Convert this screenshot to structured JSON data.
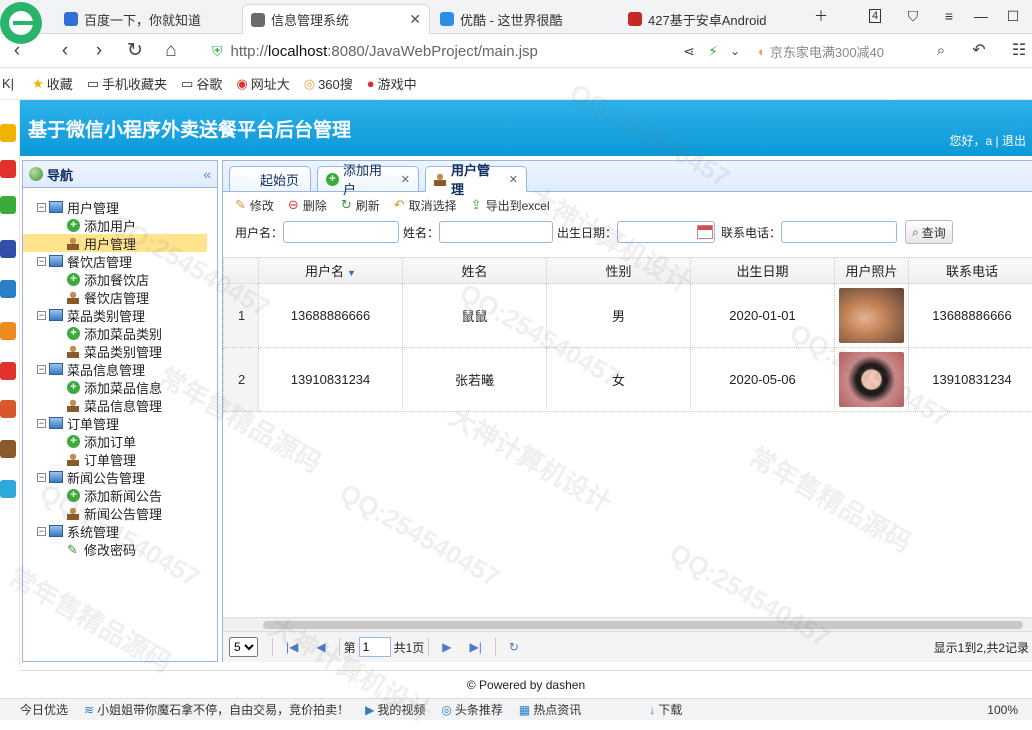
{
  "browser": {
    "tabs": [
      {
        "label": "百度一下，你就知道",
        "icon": "paw-icon",
        "color": "#2f6fd6"
      },
      {
        "label": "信息管理系统",
        "icon": "image-icon",
        "color": "#6a6a6a",
        "active": true
      },
      {
        "label": "优酷 - 这世界很酷",
        "icon": "youku-icon",
        "color": "#2a8fe6"
      },
      {
        "label": "427基于安卓Android",
        "icon": "flag-icon",
        "color": "#c62828"
      }
    ],
    "tab_count": "4",
    "url_host": "localhost",
    "url_rest": ":8080/JavaWebProject/main.jsp",
    "url_scheme": "http://",
    "search_text": "京东家电满300减40",
    "bookmarks": [
      "收藏",
      "手机收藏夹",
      "谷歌",
      "网址大",
      "360搜",
      "游戏中"
    ]
  },
  "app": {
    "title": "基于微信小程序外卖送餐平台后台管理",
    "welcome": "您好，a",
    "logout": "退出"
  },
  "nav": {
    "title": "导航",
    "groups": [
      {
        "label": "用户管理",
        "items": [
          {
            "label": "添加用户",
            "type": "add"
          },
          {
            "label": "用户管理",
            "type": "manage",
            "selected": true
          }
        ]
      },
      {
        "label": "餐饮店管理",
        "items": [
          {
            "label": "添加餐饮店",
            "type": "add"
          },
          {
            "label": "餐饮店管理",
            "type": "manage"
          }
        ]
      },
      {
        "label": "菜品类别管理",
        "items": [
          {
            "label": "添加菜品类别",
            "type": "add"
          },
          {
            "label": "菜品类别管理",
            "type": "manage"
          }
        ]
      },
      {
        "label": "菜品信息管理",
        "items": [
          {
            "label": "添加菜品信息",
            "type": "add"
          },
          {
            "label": "菜品信息管理",
            "type": "manage"
          }
        ]
      },
      {
        "label": "订单管理",
        "items": [
          {
            "label": "添加订单",
            "type": "add"
          },
          {
            "label": "订单管理",
            "type": "manage"
          }
        ]
      },
      {
        "label": "新闻公告管理",
        "items": [
          {
            "label": "添加新闻公告",
            "type": "add"
          },
          {
            "label": "新闻公告管理",
            "type": "manage"
          }
        ]
      },
      {
        "label": "系统管理",
        "items": [
          {
            "label": "修改密码",
            "type": "pen"
          }
        ]
      }
    ]
  },
  "panel_tabs": [
    {
      "label": "起始页",
      "closable": false
    },
    {
      "label": "添加用户",
      "closable": true
    },
    {
      "label": "用户管理",
      "closable": true,
      "active": true
    }
  ],
  "toolbar": {
    "edit": "修改",
    "delete": "删除",
    "refresh": "刷新",
    "unselect": "取消选择",
    "export": "导出到excel"
  },
  "search": {
    "username_label": "用户名：",
    "name_label": "姓名：",
    "birth_label": "出生日期：",
    "phone_label": "联系电话：",
    "query": "查询"
  },
  "table": {
    "columns": [
      "用户名",
      "姓名",
      "性别",
      "出生日期",
      "用户照片",
      "联系电话"
    ],
    "rows": [
      {
        "num": "1",
        "username": "13688886666",
        "name": "鼠鼠",
        "gender": "男",
        "birth": "2020-01-01",
        "phone": "13688886666"
      },
      {
        "num": "2",
        "username": "13910831234",
        "name": "张若曦",
        "gender": "女",
        "birth": "2020-05-06",
        "phone": "13910831234"
      }
    ]
  },
  "pager": {
    "page_size": "5",
    "page_prefix": "第",
    "page": "1",
    "page_suffix": "共1页",
    "info": "显示1到2,共2记录"
  },
  "footer": "© Powered by dashen",
  "statusbar": [
    "今日优选",
    "小姐姐带你魔石拿不停，自由交易，竞价拍卖！",
    "我的视频",
    "头条推荐",
    "热点资讯",
    "下载",
    "100%"
  ],
  "watermarks": [
    "QQ:254540457",
    "大神计算机设计",
    "常年售精品源码"
  ]
}
